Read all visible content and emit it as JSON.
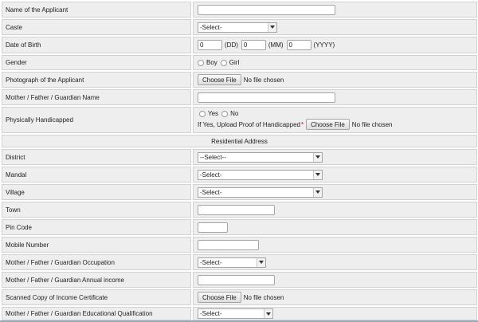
{
  "applicant_name": {
    "label": "Name of the Applicant"
  },
  "caste": {
    "label": "Caste",
    "selected": "-Select-"
  },
  "dob": {
    "label": "Date of Birth",
    "dd_value": "0",
    "dd_hint": "(DD)",
    "mm_value": "0",
    "mm_hint": "(MM)",
    "yyyy_value": "0",
    "yyyy_hint": "(YYYY)"
  },
  "gender": {
    "label": "Gender",
    "options": [
      "Boy",
      "Girl"
    ]
  },
  "photograph": {
    "label": "Photograph of the Applicant",
    "button": "Choose File",
    "status": "No file chosen"
  },
  "guardian_name": {
    "label": "Mother / Father / Guardian Name"
  },
  "handicapped": {
    "label": "Physically Handicapped",
    "options": [
      "Yes",
      "No"
    ],
    "upload_label": "If Yes, Upload Proof of Handicapped",
    "required_mark": "*",
    "button": "Choose File",
    "status": "No file chosen"
  },
  "residential_header": "Residential Address",
  "district": {
    "label": "District",
    "selected": "--Select--"
  },
  "mandal": {
    "label": "Mandal",
    "selected": "-Select-"
  },
  "village": {
    "label": "Village",
    "selected": "-Select-"
  },
  "town": {
    "label": "Town"
  },
  "pin_code": {
    "label": "Pin Code"
  },
  "mobile": {
    "label": "Mobile Number"
  },
  "occupation": {
    "label": "Mother / Father / Guardian Occupation",
    "selected": "-Select-"
  },
  "annual_income": {
    "label": "Mother / Father / Guardian Annual income"
  },
  "income_certificate": {
    "label": "Scanned Copy of Income Certificate",
    "button": "Choose File",
    "status": "No file chosen"
  },
  "education": {
    "label": "Mother / Father / Guardian Educational Qualification",
    "selected": "-Select-"
  }
}
